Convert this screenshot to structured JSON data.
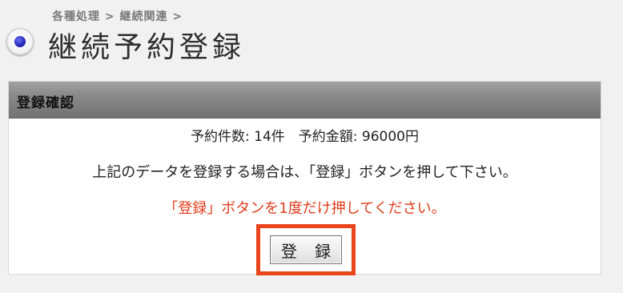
{
  "header": {
    "breadcrumb": "各種処理 > 継続関連 >",
    "title": "継続予約登録",
    "bullet_icon": "radio-bullet-icon"
  },
  "panel": {
    "heading": "登録確認",
    "summary": "予約件数: 14件　予約金額: 96000円",
    "instruction": "上記のデータを登録する場合は、「登録」ボタンを押して下さい。",
    "warning": "「登録」ボタンを1度だけ押してください。",
    "register_button_label": "登 録"
  },
  "colors": {
    "warning_text": "#e03c1c",
    "highlight_border": "#e8451c",
    "panel_header": "#8b8b8b",
    "page_background": "#f1f1f1"
  }
}
